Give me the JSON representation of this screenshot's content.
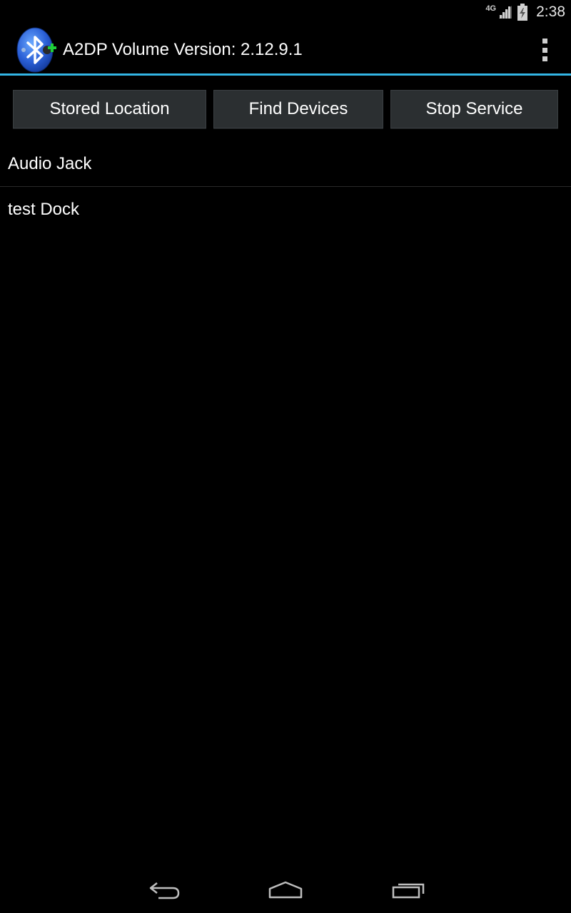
{
  "status_bar": {
    "network": "4G",
    "time": "2:38",
    "icons": [
      "signal-icon",
      "battery-charging-icon"
    ]
  },
  "action_bar": {
    "icon": "bluetooth-app-icon",
    "title": "A2DP Volume Version: 2.12.9.1",
    "overflow_icon": "overflow-menu-icon",
    "accent_color": "#33b5e5"
  },
  "buttons": [
    {
      "label": "Stored Location"
    },
    {
      "label": "Find Devices"
    },
    {
      "label": "Stop Service"
    }
  ],
  "devices": [
    {
      "name": "Audio Jack"
    },
    {
      "name": "test Dock"
    }
  ],
  "nav_bar": {
    "icons": [
      "back-icon",
      "home-icon",
      "recent-apps-icon"
    ]
  }
}
